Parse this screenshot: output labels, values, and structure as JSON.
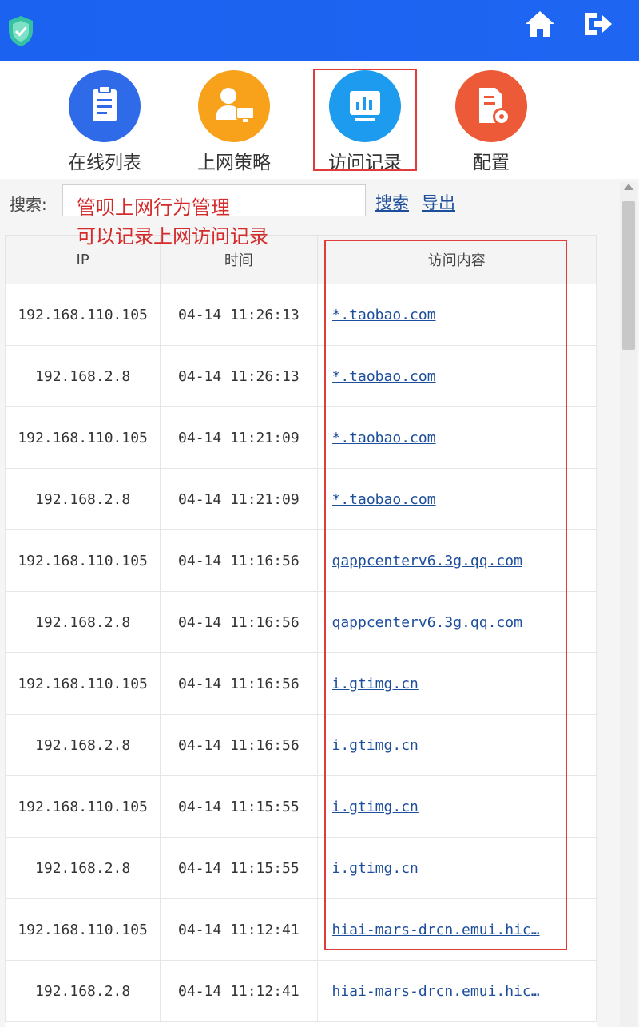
{
  "colors": {
    "topbar": "#1a62ef",
    "highlight": "#e23b3b",
    "link": "#1d4e9b"
  },
  "icons": {
    "app": "shield-logo-icon",
    "home": "home-icon",
    "logout": "logout-icon"
  },
  "nav": [
    {
      "label": "在线列表",
      "icon": "clipboard-icon",
      "color": "#2f6be8"
    },
    {
      "label": "上网策略",
      "icon": "user-monitor-icon",
      "color": "#f8a21c"
    },
    {
      "label": "访问记录",
      "icon": "chart-monitor-icon",
      "color": "#1c9bef"
    },
    {
      "label": "配置",
      "icon": "file-gear-icon",
      "color": "#ec5a37"
    }
  ],
  "search": {
    "label": "搜索:",
    "value": "",
    "search_button": "搜索",
    "export_button": "导出"
  },
  "annotation": {
    "line1": "管呗上网行为管理",
    "line2": "可以记录上网访问记录"
  },
  "table": {
    "headers": {
      "ip": "IP",
      "time": "时间",
      "content": "访问内容"
    },
    "rows": [
      {
        "ip": "192.168.110.105",
        "time": "04-14 11:26:13",
        "content": "*.taobao.com"
      },
      {
        "ip": "192.168.2.8",
        "time": "04-14 11:26:13",
        "content": "*.taobao.com"
      },
      {
        "ip": "192.168.110.105",
        "time": "04-14 11:21:09",
        "content": "*.taobao.com"
      },
      {
        "ip": "192.168.2.8",
        "time": "04-14 11:21:09",
        "content": "*.taobao.com"
      },
      {
        "ip": "192.168.110.105",
        "time": "04-14 11:16:56",
        "content": "qappcenterv6.3g.qq.com"
      },
      {
        "ip": "192.168.2.8",
        "time": "04-14 11:16:56",
        "content": "qappcenterv6.3g.qq.com"
      },
      {
        "ip": "192.168.110.105",
        "time": "04-14 11:16:56",
        "content": "i.gtimg.cn"
      },
      {
        "ip": "192.168.2.8",
        "time": "04-14 11:16:56",
        "content": "i.gtimg.cn"
      },
      {
        "ip": "192.168.110.105",
        "time": "04-14 11:15:55",
        "content": "i.gtimg.cn"
      },
      {
        "ip": "192.168.2.8",
        "time": "04-14 11:15:55",
        "content": "i.gtimg.cn"
      },
      {
        "ip": "192.168.110.105",
        "time": "04-14 11:12:41",
        "content": "hiai-mars-drcn.emui.hic…"
      },
      {
        "ip": "192.168.2.8",
        "time": "04-14 11:12:41",
        "content": "hiai-mars-drcn.emui.hic…"
      }
    ]
  }
}
